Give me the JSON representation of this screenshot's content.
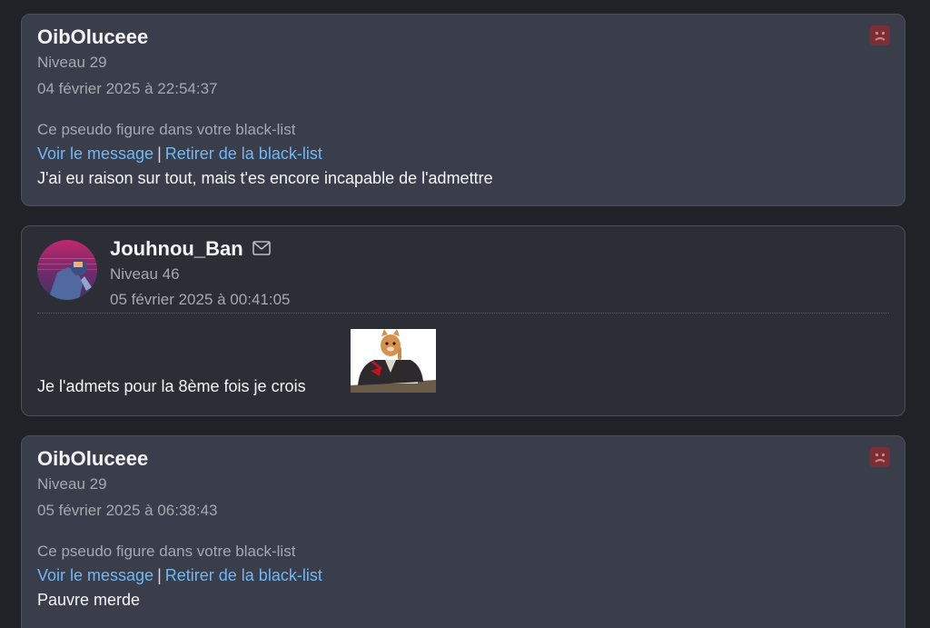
{
  "posts": [
    {
      "author": "OibOluceee",
      "level": "Niveau 29",
      "date": "04 février 2025 à 22:54:37",
      "blacklist_notice": "Ce pseudo figure dans votre black-list",
      "view_message_link": "Voir le message",
      "separator": "|",
      "remove_blacklist_link": "Retirer de la black-list",
      "message": "J'ai eu raison sur tout, mais t'es encore incapable de l'admettre",
      "report_icon": "sad-face-icon"
    },
    {
      "author": "Jouhnou_Ban",
      "level": "Niveau 46",
      "date": "05 février 2025 à 00:41:05",
      "message": "Je l'admets pour la 8ème fois je crois",
      "mail_icon": "envelope-icon",
      "sticker_icon": "cat-at-desk-sticker"
    },
    {
      "author": "OibOluceee",
      "level": "Niveau 29",
      "date": "05 février 2025 à 06:38:43",
      "blacklist_notice": "Ce pseudo figure dans votre black-list",
      "view_message_link": "Voir le message",
      "separator": "|",
      "remove_blacklist_link": "Retirer de la black-list",
      "message": "Pauvre merde",
      "report_icon": "sad-face-icon"
    }
  ],
  "colors": {
    "page_bg": "#1f2227",
    "blacklisted_card_bg": "#393e4a",
    "card_bg": "#2b2e34",
    "link": "#71b7f5",
    "report_bg": "#7b2f34"
  }
}
